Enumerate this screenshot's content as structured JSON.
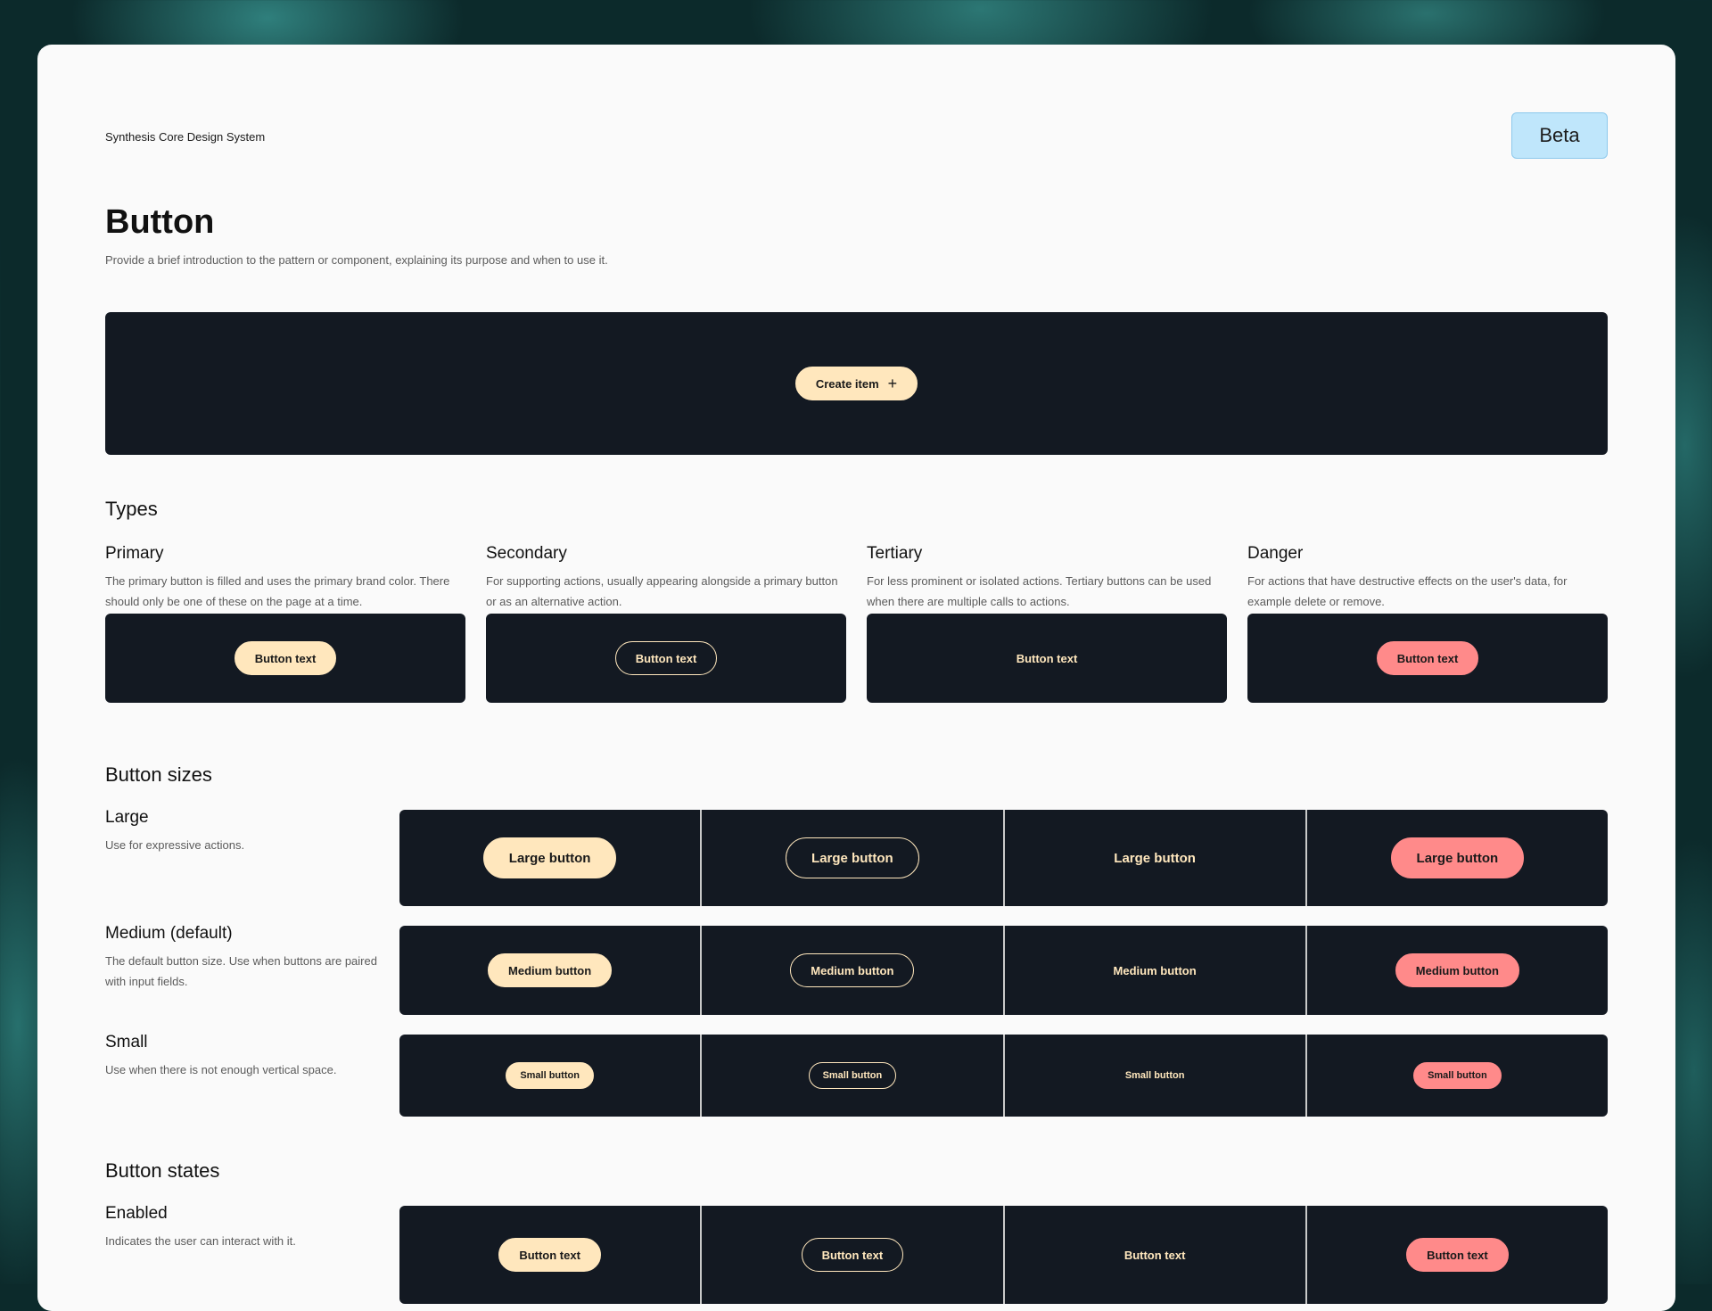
{
  "header": {
    "design_system": "Synthesis Core Design System",
    "badge": "Beta"
  },
  "page": {
    "title": "Button",
    "intro": "Provide a brief introduction to the pattern or component, explaining its purpose and when to use it."
  },
  "hero": {
    "button_label": "Create item",
    "button_icon": "plus-icon"
  },
  "types": {
    "heading": "Types",
    "items": [
      {
        "name": "Primary",
        "description": "The primary button is filled and uses the primary brand color. There should only be one of these on the page at a time.",
        "button": "Button text"
      },
      {
        "name": "Secondary",
        "description": "For supporting actions, usually appearing alongside a primary button or as an alternative action.",
        "button": "Button text"
      },
      {
        "name": "Tertiary",
        "description": "For less prominent or isolated actions. Tertiary buttons can be used when there are multiple calls to actions.",
        "button": "Button text"
      },
      {
        "name": "Danger",
        "description": "For actions that have destructive effects on the user's data, for example delete or remove.",
        "button": "Button text"
      }
    ]
  },
  "sizes": {
    "heading": "Button sizes",
    "large": {
      "name": "Large",
      "description": "Use for expressive actions.",
      "button": "Large button"
    },
    "medium": {
      "name": "Medium (default)",
      "description": "The default button size. Use when buttons are paired with input fields.",
      "button": "Medium button"
    },
    "small": {
      "name": "Small",
      "description": "Use when there is not enough vertical space.",
      "button": "Small button"
    }
  },
  "states": {
    "heading": "Button states",
    "enabled": {
      "name": "Enabled",
      "description": "Indicates the user can interact with it.",
      "button": "Button text"
    }
  },
  "colors": {
    "panel": "#131922",
    "primary": "#ffe7bd",
    "danger": "#ff8a8a",
    "badge": "#bfe6fb"
  }
}
